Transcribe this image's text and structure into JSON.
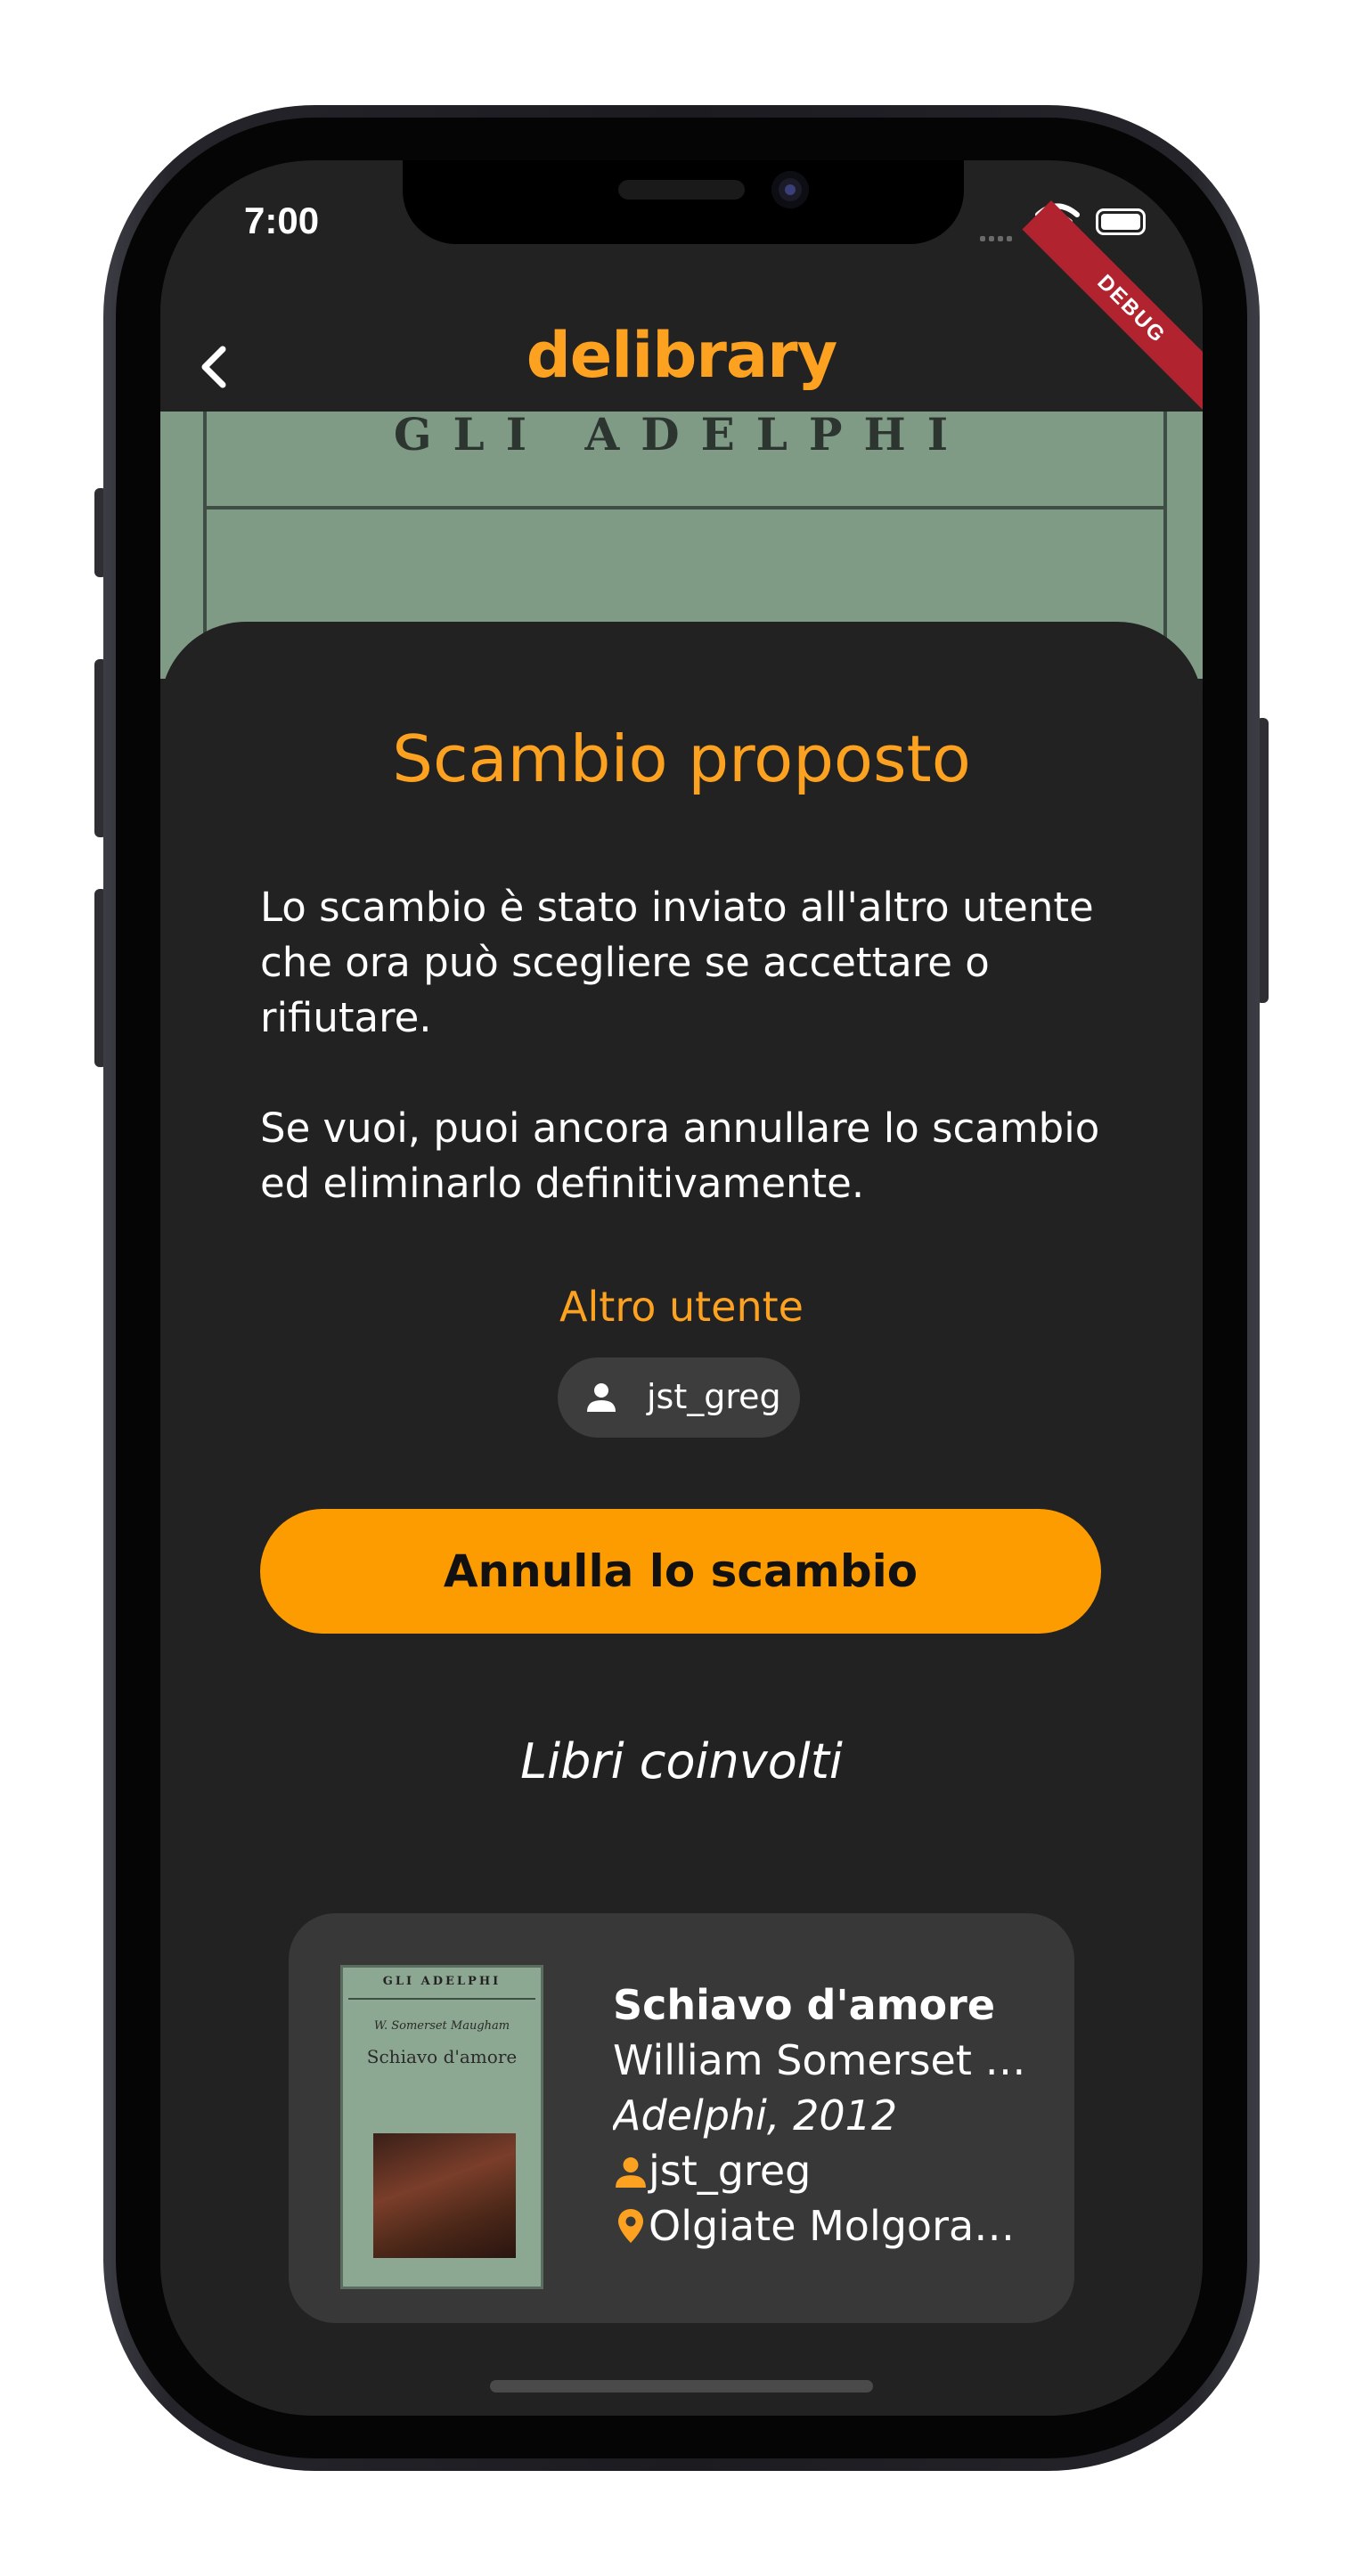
{
  "status_bar": {
    "time": "7:00",
    "debug_label": "DEBUG"
  },
  "app_bar": {
    "title": "delibrary"
  },
  "cover_strip": {
    "text": "GLI ADELPHI"
  },
  "sheet": {
    "title": "Scambio proposto",
    "paragraph_1": "Lo scambio è stato inviato all'altro utente che ora può scegliere se accettare o rifiutare.",
    "paragraph_2": "Se vuoi, puoi ancora annullare lo scambio ed eliminarlo definitivamente.",
    "other_user_label": "Altro utente",
    "other_user_name": "jst_greg",
    "cancel_button_label": "Annulla lo scambio",
    "books_section_title": "Libri coinvolti"
  },
  "book": {
    "cover_publisher": "GLI ADELPHI",
    "cover_author": "W. Somerset Maugham",
    "cover_title": "Schiavo d'amore",
    "title": "Schiavo d'amore",
    "author": "William Somerset …",
    "publisher_year": "Adelphi, 2012",
    "owner": "jst_greg",
    "location": "Olgiate Molgora…"
  },
  "colors": {
    "accent": "#fca220",
    "button": "#fd9c00",
    "background": "#222222",
    "card": "#383838",
    "chip": "#3d3d3d"
  },
  "icons": [
    "back-arrow-icon",
    "wifi-icon",
    "battery-icon",
    "person-icon",
    "location-pin-icon"
  ]
}
